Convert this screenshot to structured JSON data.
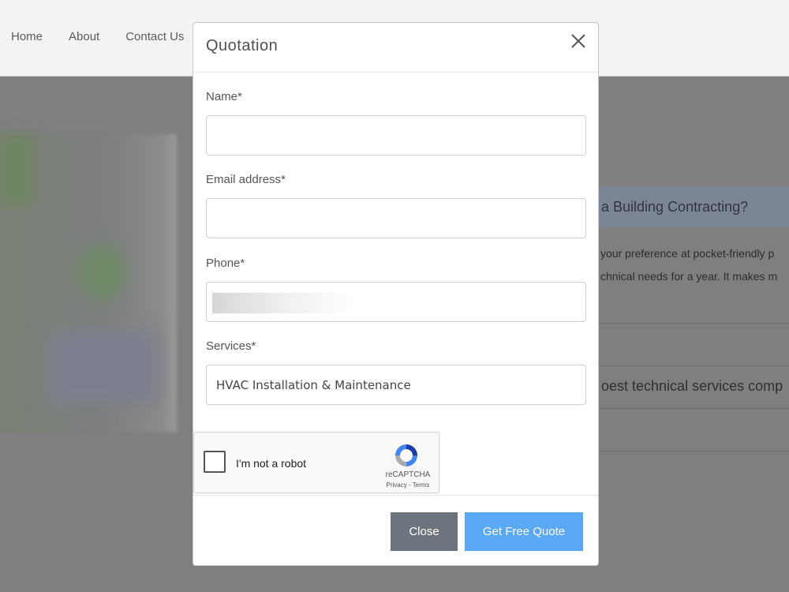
{
  "nav": {
    "items": [
      "Home",
      "About",
      "Contact Us"
    ]
  },
  "background": {
    "banner_text": "a Building Contracting?",
    "line1": "your preference at pocket-friendly p",
    "line2": "chnical needs for a year. It makes m",
    "line3": "oest technical services comp"
  },
  "modal": {
    "title": "Quotation",
    "fields": {
      "name_label": "Name*",
      "name_value": "",
      "email_label": "Email address*",
      "email_value": "",
      "phone_label": "Phone*",
      "services_label": "Services*",
      "services_value": "HVAC Installation & Maintenance"
    },
    "captcha": {
      "label": "I'm not a robot",
      "brand": "reCAPTCHA",
      "links": "Privacy - Terms"
    },
    "buttons": {
      "close": "Close",
      "submit": "Get Free Quote"
    }
  },
  "colors": {
    "primary": "#5aa9f6",
    "secondary": "#6c757d",
    "overlay": "#7f7f7f"
  }
}
